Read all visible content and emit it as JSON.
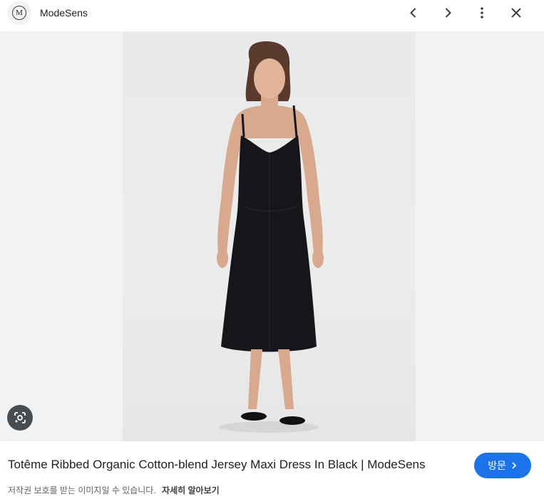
{
  "header": {
    "logo_letter": "M",
    "site_name": "ModeSens"
  },
  "icons": {
    "prev": "chevron-left-icon",
    "next": "chevron-right-icon",
    "more": "more-vertical-icon",
    "close": "close-icon",
    "lens": "google-lens-icon",
    "visit_arrow": "chevron-right-icon"
  },
  "result": {
    "title": "Totême Ribbed Organic Cotton-blend Jersey Maxi Dress In Black | ModeSens",
    "visit_label": "방문",
    "copyright_notice": "저작권 보호를 받는 이미지일 수 있습니다.",
    "learn_more": "자세히 알아보기"
  },
  "colors": {
    "accent": "#1a73e8",
    "dress": "#16161a",
    "backdrop": "#f1f3f4"
  }
}
